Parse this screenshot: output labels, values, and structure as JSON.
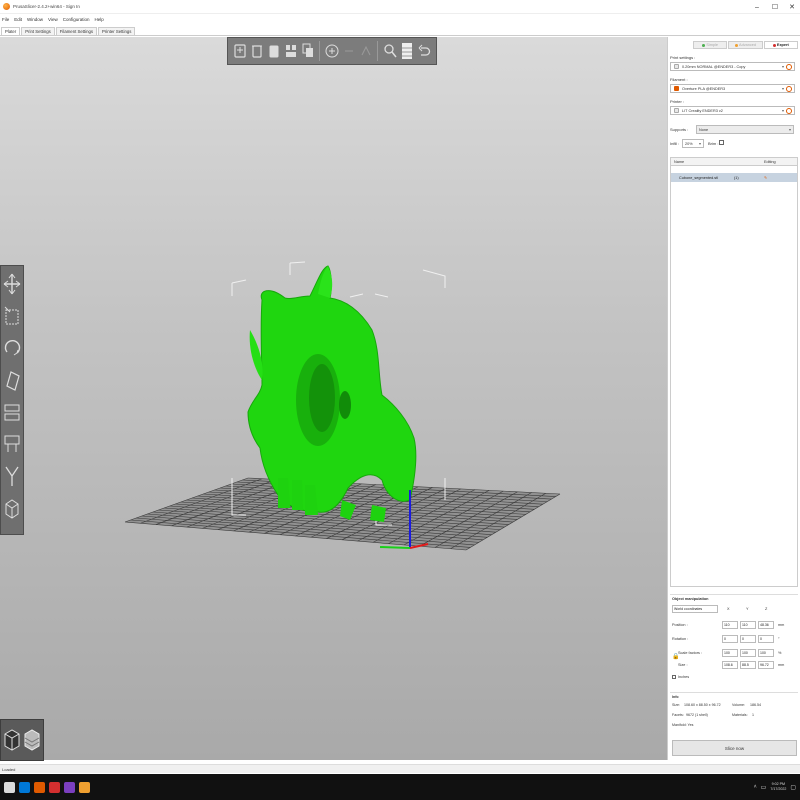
{
  "window": {
    "title": "PrusaSlicer-2.4.2+win64 - Sign In",
    "controls": [
      "–",
      "☐",
      "✕"
    ]
  },
  "menu": [
    "File",
    "Edit",
    "Window",
    "View",
    "Configuration",
    "Help"
  ],
  "tabs": [
    "Plater",
    "Print Settings",
    "Filament Settings",
    "Printer Settings"
  ],
  "toolbar": {
    "top_icons": [
      "add-icon",
      "delete-icon",
      "delete-all-icon",
      "arrange-icon",
      "copy-icon",
      "paste-icon",
      "add-instance-icon",
      "remove-instance-icon",
      "split-icon",
      "search-icon",
      "layers-icon",
      "undo-icon"
    ],
    "left_icons": [
      "move-icon",
      "scale-icon",
      "rotate-icon",
      "place-on-face-icon",
      "cut-icon",
      "supports-icon",
      "seam-icon",
      "measure-icon"
    ]
  },
  "sidebar": {
    "modes": [
      {
        "label": "Simple",
        "color": "#4caf50"
      },
      {
        "label": "Advanced",
        "color": "#f0a030"
      },
      {
        "label": "Expert",
        "color": "#d32f2f"
      }
    ],
    "print_settings_label": "Print settings :",
    "print_settings_value": "0.20mm NORMAL @ENDER3 - Copy",
    "filament_label": "Filament :",
    "filament_value": "Overture PLA @ENDER3",
    "filament_color": "#e05a00",
    "printer_label": "Printer :",
    "printer_value": "LIT Creality ENDER3 v2",
    "supports_label": "Supports :",
    "supports_value": "None",
    "infill_label": "Infill :",
    "infill_value": "20%",
    "brim_label": "Brim :",
    "list_header_name": "Name",
    "list_header_editing": "Editing",
    "object_name": "Cubone_segmented.stl",
    "object_count": "(1)"
  },
  "object_manipulation": {
    "title": "Object manipulation",
    "coord_select": "World coordinates",
    "axes": [
      "X",
      "Y",
      "Z"
    ],
    "rows": [
      {
        "label": "Position :",
        "values": [
          "110",
          "110",
          "48.36"
        ],
        "unit": "mm"
      },
      {
        "label": "Rotation :",
        "values": [
          "0",
          "0",
          "0"
        ],
        "unit": "°"
      },
      {
        "label": "Scale factors :",
        "values": [
          "100",
          "100",
          "100"
        ],
        "unit": "%"
      },
      {
        "label": "Size :",
        "values": [
          "108.6",
          "88.5",
          "96.72"
        ],
        "unit": "mm"
      }
    ],
    "inches_label": "Inches"
  },
  "info": {
    "title": "Info",
    "size_label": "Size:",
    "size_value": "108.60 x 88.50 x 96.72",
    "volume_label": "Volume:",
    "volume_value": "186.54",
    "facets_label": "Facets:",
    "facets_value": "9672 (1 shell)",
    "materials_label": "Materials:",
    "materials_value": "1",
    "manifold_label": "Manifold: Yes"
  },
  "slice_button": "Slice now",
  "status": "Loaded",
  "taskbar": {
    "icons": [
      "#0078d7",
      "#e05a00",
      "#d32f2f",
      "#7b3fbf",
      "#f0a030"
    ],
    "time": "9:02 PM",
    "date": "7/17/2022"
  }
}
